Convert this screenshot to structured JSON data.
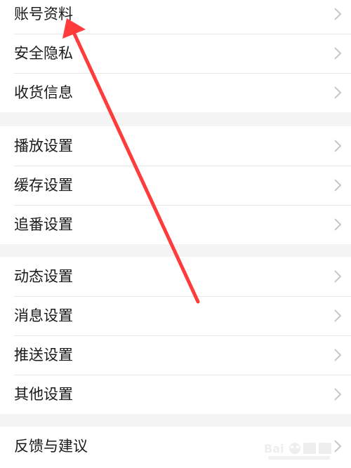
{
  "settings": {
    "groups": [
      {
        "items": [
          {
            "label": "账号资料"
          },
          {
            "label": "安全隐私"
          },
          {
            "label": "收货信息"
          }
        ]
      },
      {
        "items": [
          {
            "label": "播放设置"
          },
          {
            "label": "缓存设置"
          },
          {
            "label": "追番设置"
          }
        ]
      },
      {
        "items": [
          {
            "label": "动态设置"
          },
          {
            "label": "消息设置"
          },
          {
            "label": "推送设置"
          },
          {
            "label": "其他设置"
          }
        ]
      },
      {
        "items": [
          {
            "label": "反馈与建议"
          }
        ]
      }
    ]
  },
  "icons": {
    "row_chevron": "chevron-right-icon",
    "annotation": "red-arrow-annotation",
    "watermark": "baidu-jingyan-watermark"
  },
  "colors": {
    "background": "#f4f4f4",
    "row": "#ffffff",
    "text": "#1a1a1a",
    "chevron": "#c7c7c7",
    "arrow": "#ff3b3b"
  }
}
